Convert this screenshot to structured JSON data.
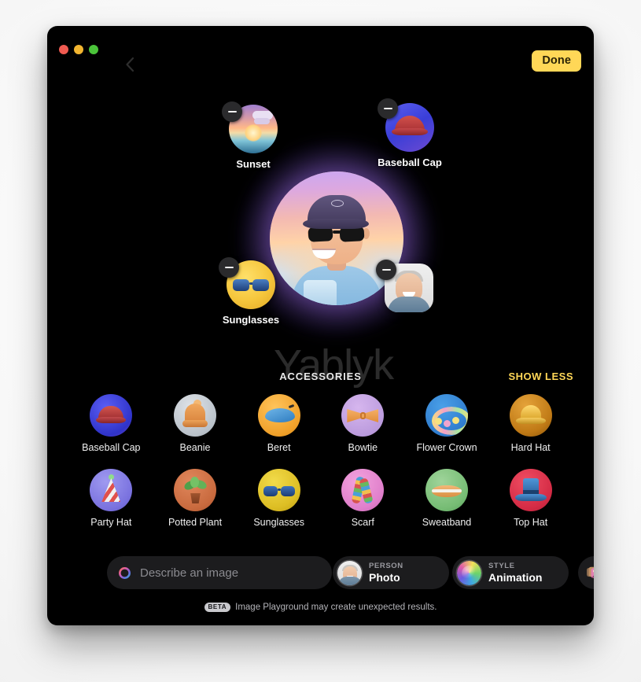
{
  "window": {
    "traffic_lights": [
      "close",
      "minimize",
      "zoom"
    ],
    "back_label": "Back",
    "done_label": "Done",
    "accent_color": "#ffd757",
    "background_color": "#000000"
  },
  "canvas": {
    "watermark": "Yablyk",
    "subject_name": "Generated avatar",
    "floating_items": [
      {
        "label": "Sunset",
        "icon": "sunset-icon",
        "remove_label": "Remove"
      },
      {
        "label": "Baseball Cap",
        "icon": "baseball-cap-icon",
        "remove_label": "Remove"
      },
      {
        "label": "Sunglasses",
        "icon": "sunglasses-icon",
        "remove_label": "Remove"
      },
      {
        "label": "",
        "icon": "person-photo-icon",
        "remove_label": "Remove"
      }
    ]
  },
  "accessories": {
    "title": "ACCESSORIES",
    "show_less_label": "SHOW LESS",
    "items": [
      {
        "label": "Baseball Cap",
        "icon": "baseball-cap-icon"
      },
      {
        "label": "Beanie",
        "icon": "beanie-icon"
      },
      {
        "label": "Beret",
        "icon": "beret-icon"
      },
      {
        "label": "Bowtie",
        "icon": "bowtie-icon"
      },
      {
        "label": "Flower Crown",
        "icon": "flower-crown-icon"
      },
      {
        "label": "Hard Hat",
        "icon": "hard-hat-icon"
      },
      {
        "label": "Party Hat",
        "icon": "party-hat-icon"
      },
      {
        "label": "Potted Plant",
        "icon": "potted-plant-icon"
      },
      {
        "label": "Sunglasses",
        "icon": "sunglasses-icon"
      },
      {
        "label": "Scarf",
        "icon": "scarf-icon"
      },
      {
        "label": "Sweatband",
        "icon": "sweatband-icon"
      },
      {
        "label": "Top Hat",
        "icon": "top-hat-icon"
      }
    ]
  },
  "toolbar": {
    "describe_placeholder": "Describe an image",
    "describe_value": "",
    "person": {
      "kicker": "PERSON",
      "value": "Photo"
    },
    "style": {
      "kicker": "STYLE",
      "value": "Animation"
    },
    "photo_button_label": "Photo library"
  },
  "footer": {
    "badge": "BETA",
    "text": "Image Playground may create unexpected results."
  }
}
